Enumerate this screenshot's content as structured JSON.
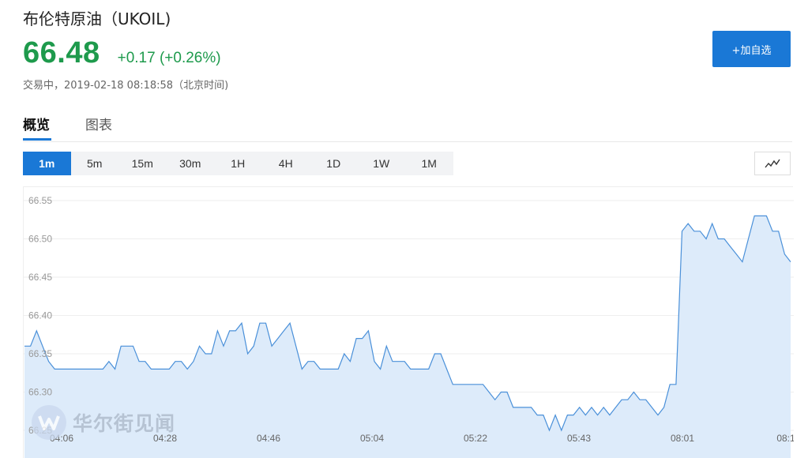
{
  "header": {
    "title": "布伦特原油（UKOIL)",
    "price": "66.48",
    "change": "+0.17 (+0.26%)",
    "status": "交易中，2019-02-18 08:18:58（北京时间)",
    "add_button": "+加自选",
    "price_color": "#1e9a4c"
  },
  "tabs": [
    {
      "label": "概览",
      "active": true
    },
    {
      "label": "图表",
      "active": false
    }
  ],
  "intervals": [
    {
      "label": "1m",
      "active": true
    },
    {
      "label": "5m",
      "active": false
    },
    {
      "label": "15m",
      "active": false
    },
    {
      "label": "30m",
      "active": false
    },
    {
      "label": "1H",
      "active": false
    },
    {
      "label": "4H",
      "active": false
    },
    {
      "label": "1D",
      "active": false
    },
    {
      "label": "1W",
      "active": false
    },
    {
      "label": "1M",
      "active": false
    }
  ],
  "chart_type_icon": "line-chart-icon",
  "accent_color": "#1a78d6",
  "watermark": {
    "text": "华尔街见闻",
    "icon": "wallstreetcn-logo-icon"
  },
  "chart_data": {
    "type": "area",
    "title": "",
    "xlabel": "",
    "ylabel": "",
    "ylim": [
      66.25,
      66.55
    ],
    "y_ticks": [
      "66.55",
      "66.50",
      "66.45",
      "66.40",
      "66.35",
      "66.30",
      "66.25"
    ],
    "x_ticks": [
      "04:06",
      "04:28",
      "04:46",
      "05:04",
      "05:22",
      "05:43",
      "08:01",
      "08:1"
    ],
    "grid": true,
    "line_color": "#4a90d9",
    "fill_color": "#ddebfa",
    "values": [
      66.36,
      66.36,
      66.38,
      66.36,
      66.34,
      66.33,
      66.33,
      66.33,
      66.33,
      66.33,
      66.33,
      66.33,
      66.33,
      66.33,
      66.34,
      66.33,
      66.36,
      66.36,
      66.36,
      66.34,
      66.34,
      66.33,
      66.33,
      66.33,
      66.33,
      66.34,
      66.34,
      66.33,
      66.34,
      66.36,
      66.35,
      66.35,
      66.38,
      66.36,
      66.38,
      66.38,
      66.39,
      66.35,
      66.36,
      66.39,
      66.39,
      66.36,
      66.37,
      66.38,
      66.39,
      66.36,
      66.33,
      66.34,
      66.34,
      66.33,
      66.33,
      66.33,
      66.33,
      66.35,
      66.34,
      66.37,
      66.37,
      66.38,
      66.34,
      66.33,
      66.36,
      66.34,
      66.34,
      66.34,
      66.33,
      66.33,
      66.33,
      66.33,
      66.35,
      66.35,
      66.33,
      66.31,
      66.31,
      66.31,
      66.31,
      66.31,
      66.31,
      66.3,
      66.29,
      66.3,
      66.3,
      66.28,
      66.28,
      66.28,
      66.28,
      66.27,
      66.27,
      66.25,
      66.27,
      66.25,
      66.27,
      66.27,
      66.28,
      66.27,
      66.28,
      66.27,
      66.28,
      66.27,
      66.28,
      66.29,
      66.29,
      66.3,
      66.29,
      66.29,
      66.28,
      66.27,
      66.28,
      66.31,
      66.31,
      66.51,
      66.52,
      66.51,
      66.51,
      66.5,
      66.52,
      66.5,
      66.5,
      66.49,
      66.48,
      66.47,
      66.5,
      66.53,
      66.53,
      66.53,
      66.51,
      66.51,
      66.48,
      66.47
    ]
  }
}
